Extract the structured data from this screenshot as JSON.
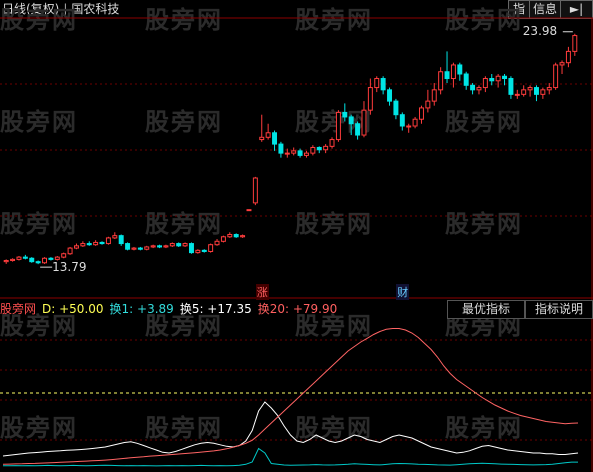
{
  "header": {
    "chart_mode": "日线(复权)",
    "stock_name": "国农科技",
    "btn_indicator": "指",
    "btn_info": "信息",
    "btn_arrow": "►|"
  },
  "watermark": "股旁网",
  "price_labels": {
    "high": "23.98",
    "low": "13.79"
  },
  "event_markers": {
    "limit_up": "涨",
    "finance": "财"
  },
  "indicator": {
    "name": "股旁网",
    "d": "D: +50.00",
    "h1": "换1: +3.89",
    "h5": "换5: +17.35",
    "h20": "换20: +79.90",
    "tab_best": "最优指标",
    "tab_help": "指标说明"
  },
  "colors": {
    "up": "#ff3c3c",
    "down": "#00e5e5",
    "h20_line": "#ff6464",
    "h5_line": "#ffffff",
    "h1_line": "#00c8c8",
    "d_line": "#ffff66",
    "label_name": "#ff5050",
    "label_d": "#ffff55",
    "label_h1": "#33dddd",
    "label_h5": "#ffffff",
    "label_h20": "#ff6060"
  },
  "chart_data": {
    "type": "candlestick",
    "ylim": [
      13.0,
      24.5
    ],
    "candles": [
      [
        13.9,
        13.95,
        13.8,
        14.0
      ],
      [
        13.95,
        14.0,
        13.9,
        14.05
      ],
      [
        14.0,
        14.1,
        13.95,
        14.15
      ],
      [
        14.1,
        14.05,
        14.0,
        14.2
      ],
      [
        14.05,
        13.9,
        13.85,
        14.1
      ],
      [
        13.9,
        13.85,
        13.79,
        13.95
      ],
      [
        13.85,
        14.05,
        13.8,
        14.1
      ],
      [
        14.05,
        14.0,
        13.95,
        14.1
      ],
      [
        14.0,
        14.1,
        13.95,
        14.15
      ],
      [
        14.1,
        14.25,
        14.05,
        14.3
      ],
      [
        14.25,
        14.5,
        14.2,
        14.55
      ],
      [
        14.5,
        14.6,
        14.45,
        14.7
      ],
      [
        14.6,
        14.7,
        14.55,
        14.8
      ],
      [
        14.7,
        14.65,
        14.6,
        14.8
      ],
      [
        14.65,
        14.75,
        14.6,
        14.85
      ],
      [
        14.75,
        14.7,
        14.65,
        14.8
      ],
      [
        14.7,
        14.95,
        14.65,
        15.0
      ],
      [
        14.95,
        15.05,
        14.9,
        15.2
      ],
      [
        15.05,
        14.7,
        14.6,
        15.1
      ],
      [
        14.7,
        14.45,
        14.4,
        14.75
      ],
      [
        14.45,
        14.5,
        14.4,
        14.55
      ],
      [
        14.5,
        14.45,
        14.4,
        14.55
      ],
      [
        14.45,
        14.55,
        14.4,
        14.6
      ],
      [
        14.55,
        14.6,
        14.5,
        14.65
      ],
      [
        14.6,
        14.55,
        14.5,
        14.65
      ],
      [
        14.55,
        14.6,
        14.5,
        14.65
      ],
      [
        14.6,
        14.7,
        14.55,
        14.75
      ],
      [
        14.7,
        14.6,
        14.55,
        14.75
      ],
      [
        14.6,
        14.7,
        14.55,
        14.75
      ],
      [
        14.7,
        14.3,
        14.25,
        14.75
      ],
      [
        14.3,
        14.4,
        14.25,
        14.45
      ],
      [
        14.4,
        14.35,
        14.3,
        14.45
      ],
      [
        14.35,
        14.65,
        14.3,
        14.7
      ],
      [
        14.65,
        14.8,
        14.6,
        14.9
      ],
      [
        14.8,
        15.0,
        14.75,
        15.05
      ],
      [
        15.0,
        15.1,
        14.95,
        15.2
      ],
      [
        15.1,
        15.0,
        14.95,
        15.15
      ],
      [
        15.0,
        15.05,
        14.95,
        15.1
      ],
      [
        16.2,
        16.2,
        16.2,
        16.2
      ],
      [
        16.5,
        17.6,
        16.4,
        17.65
      ],
      [
        19.3,
        19.4,
        19.2,
        20.4
      ],
      [
        19.4,
        19.6,
        19.3,
        20.0
      ],
      [
        19.6,
        19.1,
        18.8,
        19.7
      ],
      [
        19.1,
        18.7,
        18.5,
        19.2
      ],
      [
        18.7,
        18.7,
        18.5,
        18.9
      ],
      [
        18.7,
        18.8,
        18.6,
        18.95
      ],
      [
        18.8,
        18.6,
        18.5,
        18.9
      ],
      [
        18.6,
        18.7,
        18.5,
        18.8
      ],
      [
        18.7,
        18.95,
        18.6,
        19.05
      ],
      [
        18.95,
        18.85,
        18.7,
        19.0
      ],
      [
        18.85,
        19.0,
        18.7,
        19.1
      ],
      [
        19.0,
        19.3,
        18.9,
        19.4
      ],
      [
        19.3,
        20.5,
        19.2,
        20.6
      ],
      [
        20.5,
        20.3,
        20.1,
        20.9
      ],
      [
        20.3,
        20.0,
        19.5,
        20.4
      ],
      [
        20.0,
        19.5,
        19.3,
        20.1
      ],
      [
        19.5,
        20.6,
        19.4,
        21.0
      ],
      [
        20.6,
        21.6,
        20.4,
        22.0
      ],
      [
        21.6,
        22.0,
        21.4,
        22.1
      ],
      [
        22.0,
        21.5,
        21.3,
        22.1
      ],
      [
        21.5,
        21.0,
        20.8,
        21.6
      ],
      [
        21.0,
        20.4,
        20.2,
        21.1
      ],
      [
        20.4,
        19.9,
        19.7,
        20.5
      ],
      [
        19.9,
        19.9,
        19.6,
        20.0
      ],
      [
        19.9,
        20.2,
        19.8,
        20.3
      ],
      [
        20.2,
        20.7,
        20.0,
        20.8
      ],
      [
        20.7,
        21.0,
        20.5,
        21.5
      ],
      [
        21.0,
        21.5,
        20.8,
        21.8
      ],
      [
        21.5,
        22.3,
        21.3,
        22.5
      ],
      [
        22.3,
        22.0,
        21.8,
        23.2
      ],
      [
        22.0,
        22.6,
        21.6,
        22.7
      ],
      [
        22.6,
        22.2,
        21.9,
        22.7
      ],
      [
        22.2,
        21.7,
        21.5,
        22.3
      ],
      [
        21.7,
        21.5,
        21.3,
        21.8
      ],
      [
        21.5,
        21.6,
        21.3,
        21.7
      ],
      [
        21.6,
        22.0,
        21.4,
        22.1
      ],
      [
        22.0,
        21.9,
        21.7,
        22.2
      ],
      [
        21.9,
        22.1,
        21.6,
        22.2
      ],
      [
        22.1,
        22.0,
        21.7,
        22.2
      ],
      [
        22.0,
        21.3,
        21.1,
        22.1
      ],
      [
        21.3,
        21.3,
        21.1,
        21.5
      ],
      [
        21.3,
        21.5,
        21.2,
        21.7
      ],
      [
        21.5,
        21.6,
        21.2,
        21.7
      ],
      [
        21.6,
        21.3,
        21.0,
        21.7
      ],
      [
        21.3,
        21.5,
        21.1,
        21.6
      ],
      [
        21.5,
        21.6,
        21.3,
        21.8
      ],
      [
        21.6,
        22.6,
        21.5,
        22.7
      ],
      [
        22.6,
        22.7,
        22.2,
        22.8
      ],
      [
        22.7,
        23.2,
        22.5,
        23.4
      ],
      [
        23.2,
        23.9,
        23.0,
        23.98
      ]
    ],
    "limit_up_index": 40,
    "finance_index": 62,
    "sub": {
      "ylim": [
        0,
        100
      ],
      "h20": [
        2.5,
        2.6,
        2.7,
        2.8,
        3.0,
        3.1,
        3.3,
        3.4,
        3.6,
        3.8,
        4.0,
        4.2,
        4.4,
        4.6,
        4.8,
        5.0,
        5.3,
        5.6,
        6.0,
        6.4,
        6.8,
        7.2,
        7.5,
        7.9,
        8.2,
        8.5,
        8.8,
        9.2,
        9.5,
        9.8,
        10.2,
        10.6,
        11.0,
        11.4,
        12.0,
        12.8,
        13.8,
        15.0,
        16.5,
        18.5,
        22.0,
        26.0,
        30.0,
        34.0,
        38.0,
        42.0,
        46.0,
        50.0,
        54.0,
        58.0,
        62.0,
        66.0,
        70.0,
        74.0,
        78.0,
        81.0,
        84.0,
        86.5,
        89.0,
        91.0,
        92.5,
        93.0,
        93.0,
        92.0,
        90.0,
        87.0,
        83.0,
        79.0,
        74.0,
        68.0,
        63.0,
        59.0,
        56.0,
        53.0,
        50.0,
        47.0,
        44.5,
        42.0,
        40.0,
        38.0,
        36.5,
        35.0,
        34.0,
        33.0,
        32.0,
        31.0,
        30.5,
        30.0,
        29.5,
        29.8,
        30.0
      ],
      "h5": [
        8,
        8.5,
        9,
        9.5,
        10,
        10.3,
        10.6,
        11,
        11.3,
        11.5,
        11.8,
        12,
        12.3,
        12.6,
        13,
        13.5,
        14,
        15,
        16,
        17,
        17.5,
        16.5,
        15,
        13.5,
        12,
        10.5,
        10,
        11,
        12.5,
        14,
        15.5,
        16.5,
        17,
        16.5,
        15.5,
        14.5,
        14,
        15,
        18,
        25,
        38,
        44,
        40,
        35,
        28,
        22,
        18,
        17,
        19,
        22,
        20,
        18,
        17,
        18,
        20,
        22,
        21,
        19,
        18,
        17,
        19,
        21,
        22,
        21,
        20,
        18,
        16,
        14,
        13,
        12,
        11,
        10,
        10.5,
        11.5,
        13,
        14.5,
        15,
        14,
        13,
        12,
        11.5,
        11,
        10.5,
        10,
        10,
        9.5,
        9.5,
        9,
        9,
        9.5,
        10
      ],
      "h1": [
        1.5,
        1.5,
        1.6,
        1.5,
        1.6,
        1.5,
        1.6,
        1.7,
        1.6,
        1.5,
        1.6,
        1.7,
        1.6,
        1.5,
        1.6,
        1.7,
        1.8,
        1.7,
        1.6,
        1.5,
        1.6,
        1.5,
        1.6,
        1.5,
        1.4,
        1.5,
        1.6,
        1.5,
        1.6,
        1.5,
        1.6,
        1.7,
        1.6,
        1.5,
        1.6,
        1.5,
        1.6,
        1.8,
        2.5,
        4.0,
        13.0,
        10.0,
        3.0,
        2.5,
        2.0,
        1.8,
        1.9,
        2.0,
        2.1,
        2.3,
        2.1,
        2.0,
        2.1,
        2.3,
        2.5,
        2.8,
        2.6,
        2.4,
        2.2,
        2.1,
        2.4,
        2.8,
        3.0,
        2.9,
        2.7,
        2.5,
        2.4,
        2.3,
        2.1,
        2.0,
        1.9,
        2.2,
        2.5,
        2.8,
        3.0,
        3.2,
        3.0,
        2.8,
        2.6,
        2.5,
        2.4,
        2.3,
        2.2,
        2.1,
        2.2,
        2.3,
        2.5,
        3.0,
        3.5,
        3.9,
        3.9
      ],
      "d_level": 50
    }
  }
}
